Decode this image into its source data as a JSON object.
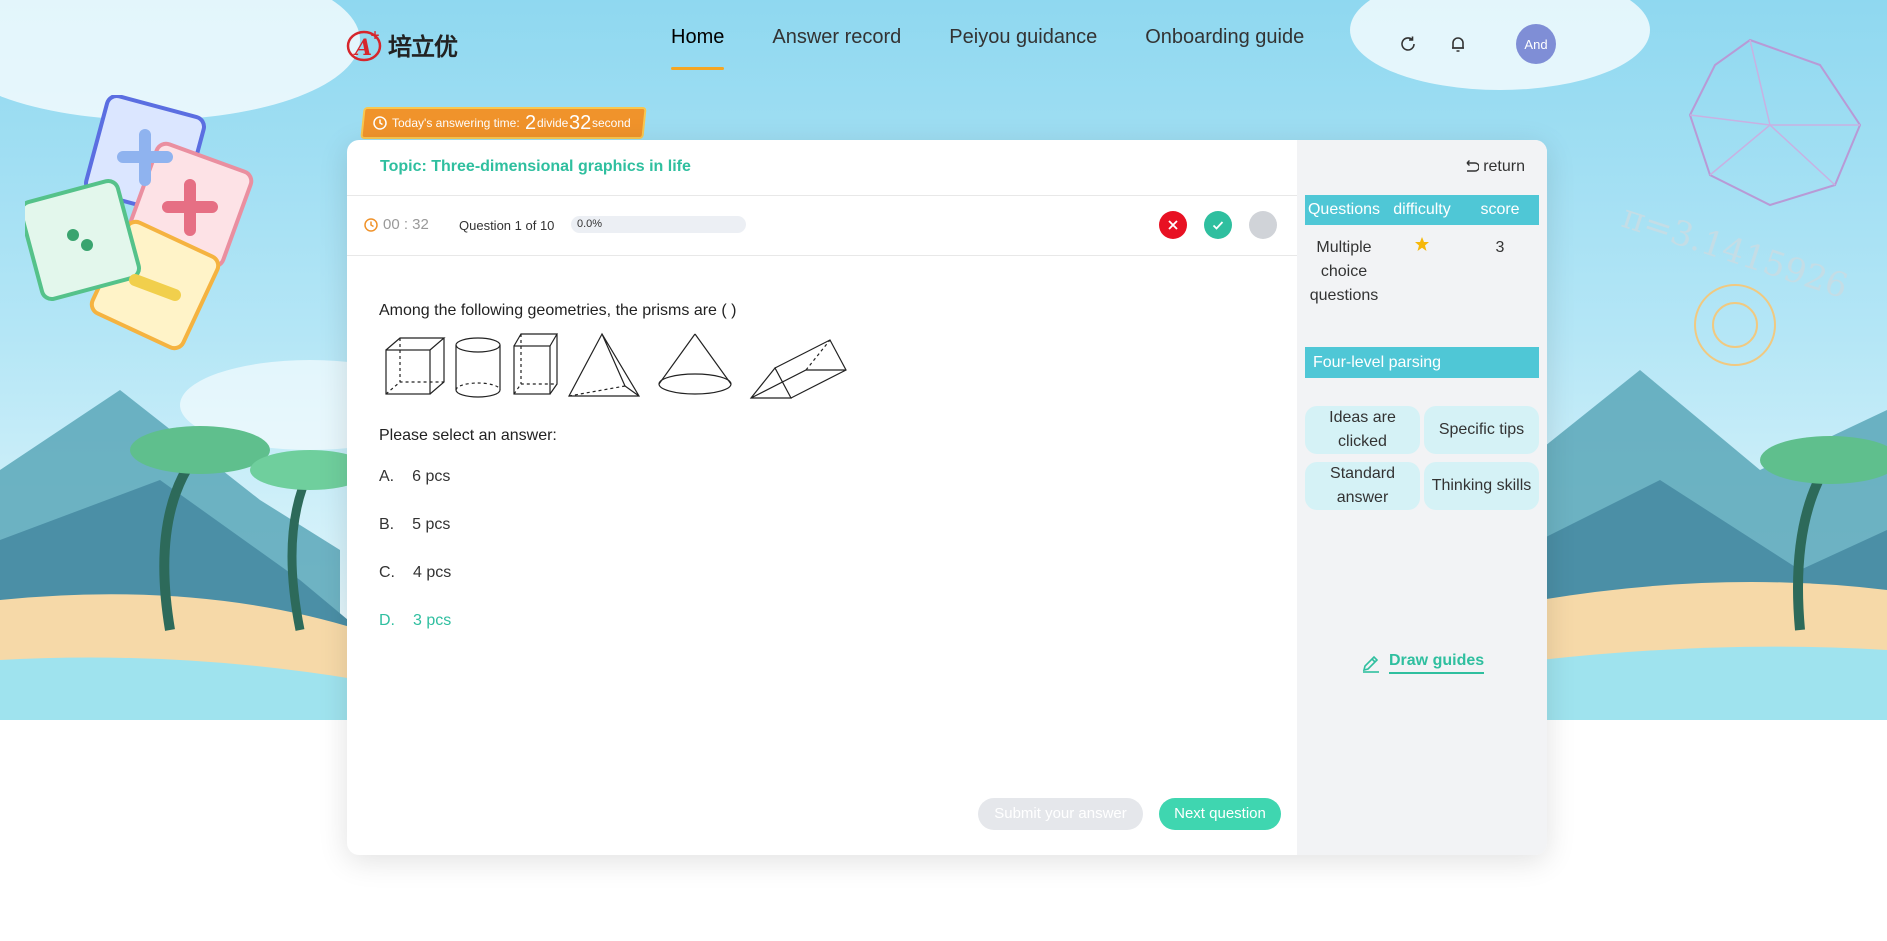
{
  "header": {
    "logo_text": "培立优",
    "nav": [
      {
        "label": "Home",
        "active": true
      },
      {
        "label": "Answer record",
        "active": false
      },
      {
        "label": "Peiyou guidance",
        "active": false
      },
      {
        "label": "Onboarding guide",
        "active": false
      }
    ],
    "icons": [
      "refresh-icon",
      "bell-icon"
    ],
    "avatar_text": "And"
  },
  "timer_banner": {
    "prefix": "Today's answering time:",
    "minutes": "2",
    "minutes_unit": "divide",
    "seconds": "32",
    "seconds_unit": "second"
  },
  "quiz": {
    "topic": "Topic: Three-dimensional graphics in life",
    "elapsed": "00 : 32",
    "question_count": "Question 1 of 10",
    "progress_text": "0.0%",
    "progress_value": 0,
    "question": "Among the following geometries, the prisms are ( )",
    "prompt": "Please select an answer:",
    "options": [
      {
        "letter": "A.",
        "text": "6 pcs",
        "selected": false
      },
      {
        "letter": "B.",
        "text": "5 pcs",
        "selected": false
      },
      {
        "letter": "C.",
        "text": "4 pcs",
        "selected": false
      },
      {
        "letter": "D.",
        "text": "3 pcs",
        "selected": true
      }
    ],
    "submit_label": "Submit your answer",
    "next_label": "Next question",
    "colors": {
      "accent": "#2fbfa0",
      "wrong": "#e81123",
      "right": "#2fbf9f",
      "unanswered": "#d0d3d8"
    }
  },
  "sidebar": {
    "return_label": "return",
    "table_headers": [
      "Questions",
      "difficulty",
      "score"
    ],
    "row": {
      "type": "Multiple choice questions",
      "difficulty_stars": 1,
      "score": "3"
    },
    "section_title": "Four-level parsing",
    "chips": [
      "Ideas are clicked",
      "Specific tips",
      "Standard answer",
      "Thinking skills"
    ],
    "draw_label": "Draw guides"
  }
}
